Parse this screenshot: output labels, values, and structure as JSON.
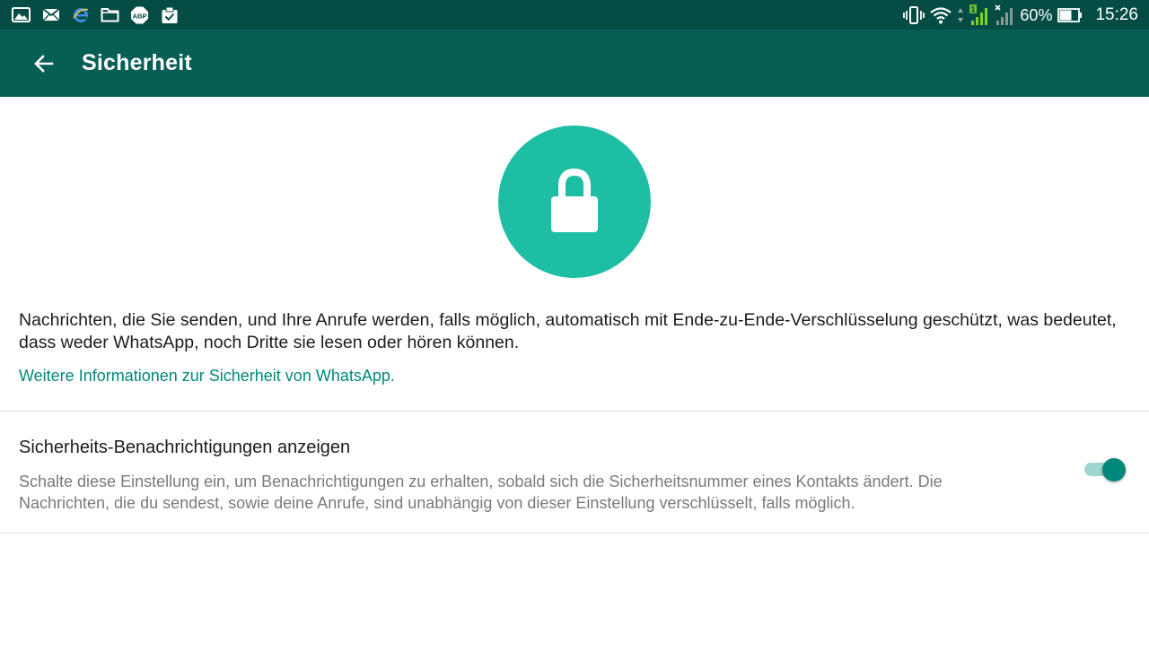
{
  "status_bar": {
    "notification_icons": [
      "gallery-icon",
      "email-icon",
      "browser-icon",
      "folder-icon",
      "adblock-icon",
      "clipboard-check-icon"
    ],
    "adblock_label": "ABP",
    "sim_label": "1",
    "battery_percent": "60%",
    "time": "15:26"
  },
  "app_bar": {
    "title": "Sicherheit",
    "background": "#075e54"
  },
  "hero": {
    "icon": "lock-icon",
    "circle_color": "#1ebea5"
  },
  "main": {
    "description": "Nachrichten, die Sie senden, und Ihre Anrufe werden, falls möglich, automatisch mit Ende-zu-Ende-Verschlüsselung geschützt, was bedeutet, dass weder WhatsApp, noch Dritte sie lesen oder hören können.",
    "learn_more_link": "Weitere Informationen zur Sicherheit von WhatsApp.",
    "link_color": "#00897b"
  },
  "security_notifications": {
    "title": "Sicherheits-Benachrichtigungen anzeigen",
    "description": "Schalte diese Einstellung ein, um Benachrichtigungen zu erhalten, sobald sich die Sicherheitsnummer eines Kontakts ändert. Die Nachrichten, die du sendest, sowie deine Anrufe, sind unabhängig von dieser Einstellung verschlüsselt, falls möglich.",
    "enabled": true,
    "toggle_color": "#00897b"
  }
}
